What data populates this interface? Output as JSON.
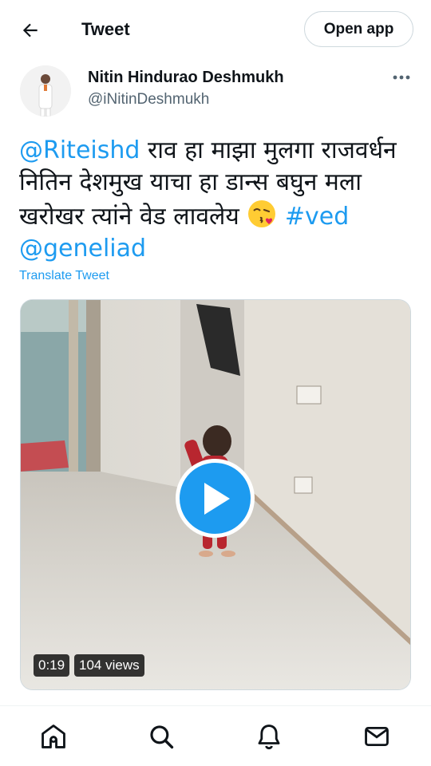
{
  "topbar": {
    "title": "Tweet",
    "open_app_label": "Open app",
    "back_icon": "arrow-left-icon"
  },
  "author": {
    "name": "Nitin Hindurao Deshmukh",
    "handle": "@iNitinDeshmukh",
    "more_icon": "more-dots-icon"
  },
  "tweet": {
    "mention1": "@Riteishd",
    "text1": " राव हा माझा मुलगा राजवर्धन नितिन देशमुख याचा हा डान्स बघुन मला खरोखर त्यांने वेड लावलेय ",
    "emoji": "😘",
    "hashtag": "#ved",
    "mention2": "@geneliad",
    "translate_label": "Translate Tweet"
  },
  "media": {
    "duration": "0:19",
    "views": "104 views",
    "play_icon": "play-icon"
  },
  "bottom_nav": {
    "items": [
      "home-icon",
      "search-icon",
      "notifications-icon",
      "messages-icon"
    ]
  },
  "colors": {
    "accent": "#1d9bf0",
    "text": "#0f1419",
    "muted": "#536471",
    "border": "#cfd9de"
  }
}
